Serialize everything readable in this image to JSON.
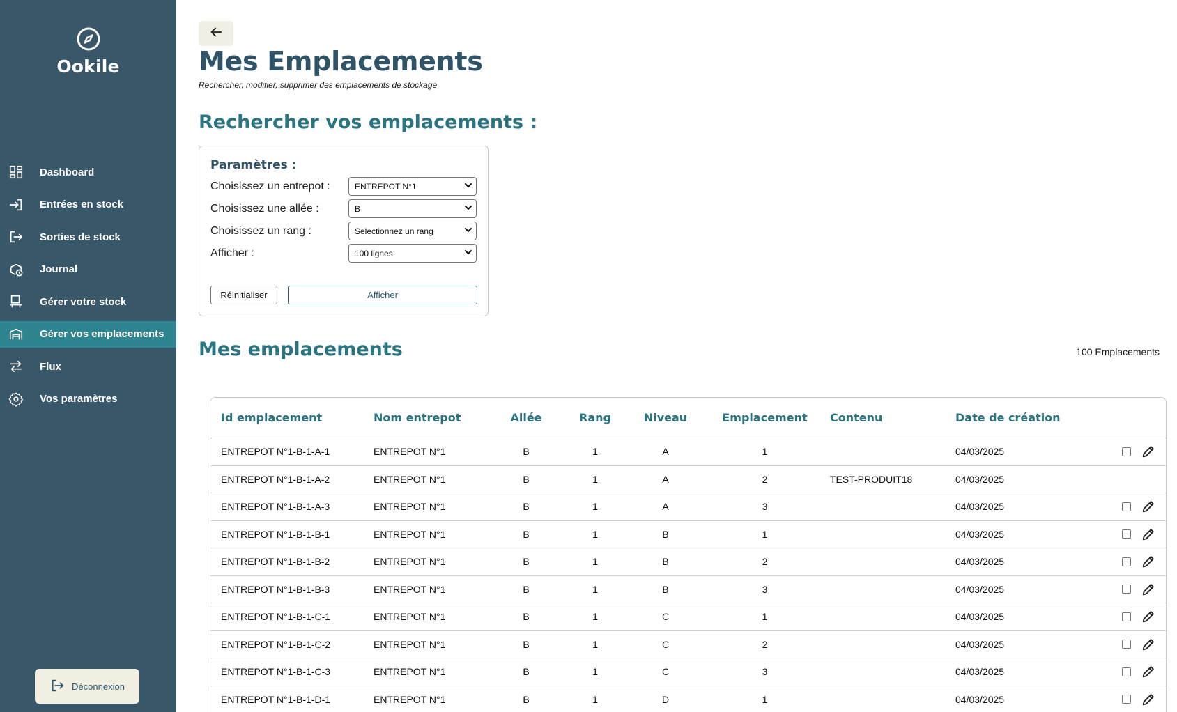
{
  "app": {
    "name": "Ookile"
  },
  "sidebar": {
    "items": [
      {
        "label": "Dashboard",
        "icon": "dashboard-icon",
        "active": false
      },
      {
        "label": "Entrées en stock",
        "icon": "login-icon",
        "active": false
      },
      {
        "label": "Sorties de stock",
        "icon": "logout-icon",
        "active": false
      },
      {
        "label": "Journal",
        "icon": "history-icon",
        "active": false
      },
      {
        "label": "Gérer votre stock",
        "icon": "forklift-icon",
        "active": false
      },
      {
        "label": "Gérer vos emplacements",
        "icon": "warehouse-icon",
        "active": true
      },
      {
        "label": "Flux",
        "icon": "flow-arrows-icon",
        "active": false
      },
      {
        "label": "Vos paramètres",
        "icon": "gear-icon",
        "active": false
      }
    ],
    "logout_label": "Déconnexion"
  },
  "page": {
    "title": "Mes Emplacements",
    "subtitle": "Rechercher, modifier, supprimer des emplacements de stockage",
    "search_title": "Rechercher vos emplacements :",
    "list_title": "Mes emplacements",
    "count_label": "100 Emplacements"
  },
  "params": {
    "title": "Paramètres :",
    "rows": [
      {
        "label": "Choisissez un entrepot :",
        "value": "ENTREPOT N°1"
      },
      {
        "label": "Choisissez une allée :",
        "value": "B"
      },
      {
        "label": "Choisissez un rang :",
        "value": "Selectionnez un rang"
      },
      {
        "label": "Afficher :",
        "value": "100 lignes"
      }
    ],
    "reset_label": "Réinitialiser",
    "show_label": "Afficher"
  },
  "table": {
    "headers": [
      "Id emplacement",
      "Nom entrepot",
      "Allée",
      "Rang",
      "Niveau",
      "Emplacement",
      "Contenu",
      "Date de création"
    ],
    "rows": [
      {
        "id": "ENTREPOT N°1-B-1-A-1",
        "nom": "ENTREPOT N°1",
        "allee": "B",
        "rang": "1",
        "niveau": "A",
        "emplacement": "1",
        "contenu": "",
        "date": "04/03/2025",
        "actions": true
      },
      {
        "id": "ENTREPOT N°1-B-1-A-2",
        "nom": "ENTREPOT N°1",
        "allee": "B",
        "rang": "1",
        "niveau": "A",
        "emplacement": "2",
        "contenu": "TEST-PRODUIT18",
        "date": "04/03/2025",
        "actions": false
      },
      {
        "id": "ENTREPOT N°1-B-1-A-3",
        "nom": "ENTREPOT N°1",
        "allee": "B",
        "rang": "1",
        "niveau": "A",
        "emplacement": "3",
        "contenu": "",
        "date": "04/03/2025",
        "actions": true
      },
      {
        "id": "ENTREPOT N°1-B-1-B-1",
        "nom": "ENTREPOT N°1",
        "allee": "B",
        "rang": "1",
        "niveau": "B",
        "emplacement": "1",
        "contenu": "",
        "date": "04/03/2025",
        "actions": true
      },
      {
        "id": "ENTREPOT N°1-B-1-B-2",
        "nom": "ENTREPOT N°1",
        "allee": "B",
        "rang": "1",
        "niveau": "B",
        "emplacement": "2",
        "contenu": "",
        "date": "04/03/2025",
        "actions": true
      },
      {
        "id": "ENTREPOT N°1-B-1-B-3",
        "nom": "ENTREPOT N°1",
        "allee": "B",
        "rang": "1",
        "niveau": "B",
        "emplacement": "3",
        "contenu": "",
        "date": "04/03/2025",
        "actions": true
      },
      {
        "id": "ENTREPOT N°1-B-1-C-1",
        "nom": "ENTREPOT N°1",
        "allee": "B",
        "rang": "1",
        "niveau": "C",
        "emplacement": "1",
        "contenu": "",
        "date": "04/03/2025",
        "actions": true
      },
      {
        "id": "ENTREPOT N°1-B-1-C-2",
        "nom": "ENTREPOT N°1",
        "allee": "B",
        "rang": "1",
        "niveau": "C",
        "emplacement": "2",
        "contenu": "",
        "date": "04/03/2025",
        "actions": true
      },
      {
        "id": "ENTREPOT N°1-B-1-C-3",
        "nom": "ENTREPOT N°1",
        "allee": "B",
        "rang": "1",
        "niveau": "C",
        "emplacement": "3",
        "contenu": "",
        "date": "04/03/2025",
        "actions": true
      },
      {
        "id": "ENTREPOT N°1-B-1-D-1",
        "nom": "ENTREPOT N°1",
        "allee": "B",
        "rang": "1",
        "niveau": "D",
        "emplacement": "1",
        "contenu": "",
        "date": "04/03/2025",
        "actions": true
      }
    ]
  },
  "colors": {
    "sidebar_bg": "#385769",
    "sidebar_active": "#2e8590",
    "title": "#2f5468",
    "accent": "#2b7482",
    "logout_bg": "#f1efe2"
  }
}
